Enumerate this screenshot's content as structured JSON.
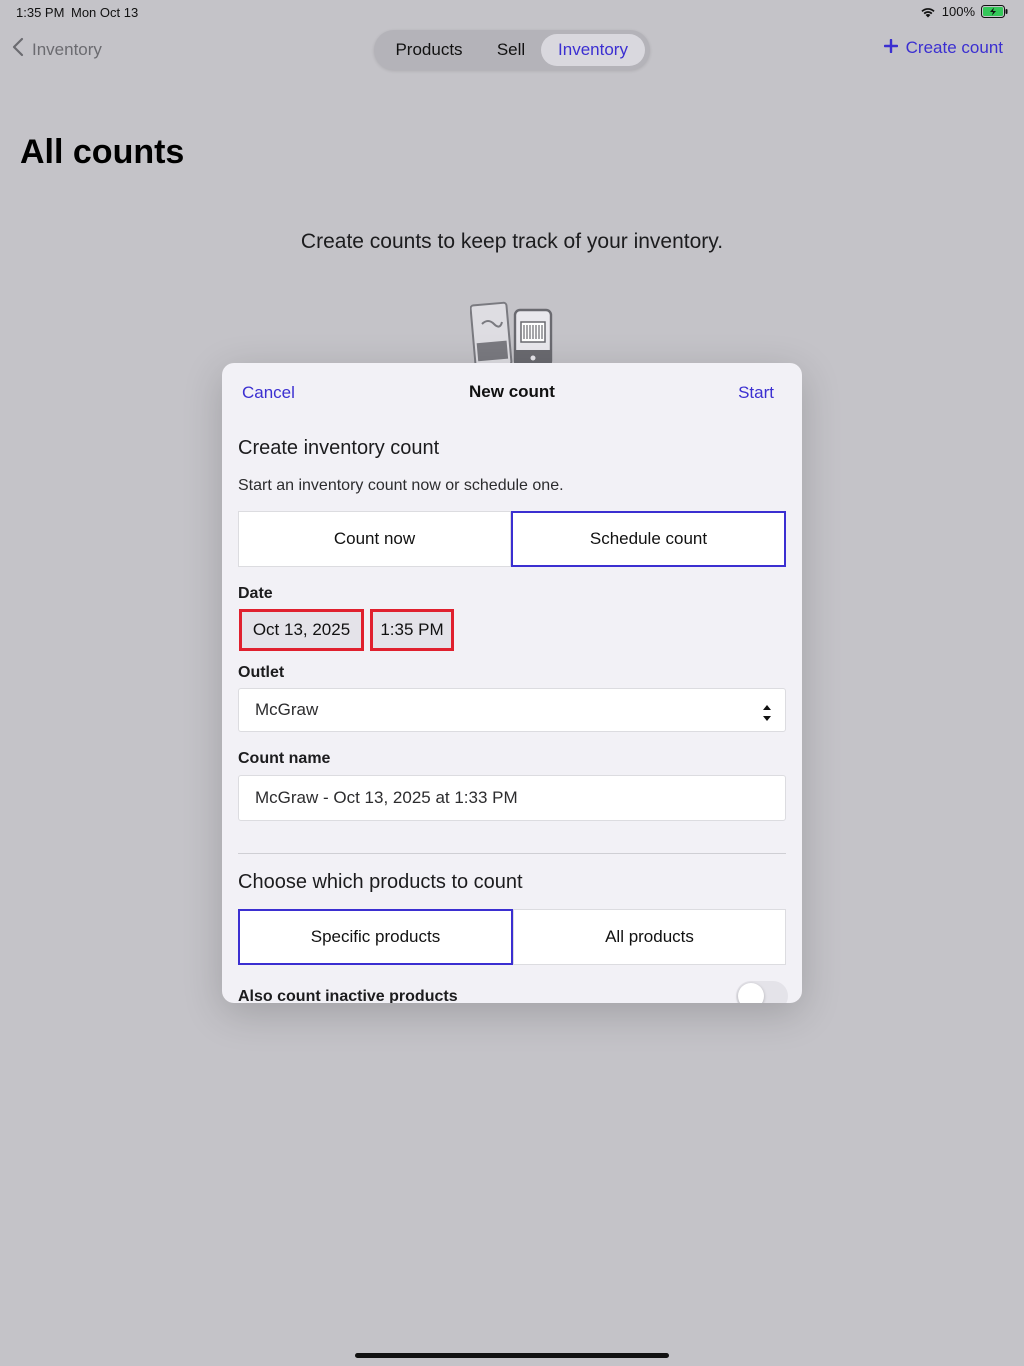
{
  "status_bar": {
    "time": "1:35 PM",
    "date": "Mon Oct 13",
    "battery": "100%"
  },
  "nav": {
    "back_label": "Inventory",
    "tabs": [
      "Products",
      "Sell",
      "Inventory"
    ],
    "selected_tab": "Inventory",
    "create_label": "Create count"
  },
  "page": {
    "title": "All counts",
    "empty_message": "Create counts to keep track of your inventory."
  },
  "modal": {
    "cancel_label": "Cancel",
    "title": "New count",
    "start_label": "Start",
    "heading": "Create inventory count",
    "subtitle": "Start an inventory count now or schedule one.",
    "mode_options": [
      "Count now",
      "Schedule count"
    ],
    "selected_mode": "Schedule count",
    "date_label": "Date",
    "date_value": "Oct 13, 2025",
    "time_value": "1:35 PM",
    "outlet_label": "Outlet",
    "outlet_value": "McGraw",
    "count_name_label": "Count name",
    "count_name_value": "McGraw - Oct 13, 2025 at 1:33 PM",
    "products_heading": "Choose which products to count",
    "product_options": [
      "Specific products",
      "All products"
    ],
    "selected_product_option": "Specific products",
    "inactive_label": "Also count inactive products",
    "inactive_enabled": false
  },
  "colors": {
    "accent": "#3b2fd1",
    "highlight_box": "#e0202e",
    "backdrop": "#c4c3c8",
    "modal_bg": "#f2f1f6"
  }
}
